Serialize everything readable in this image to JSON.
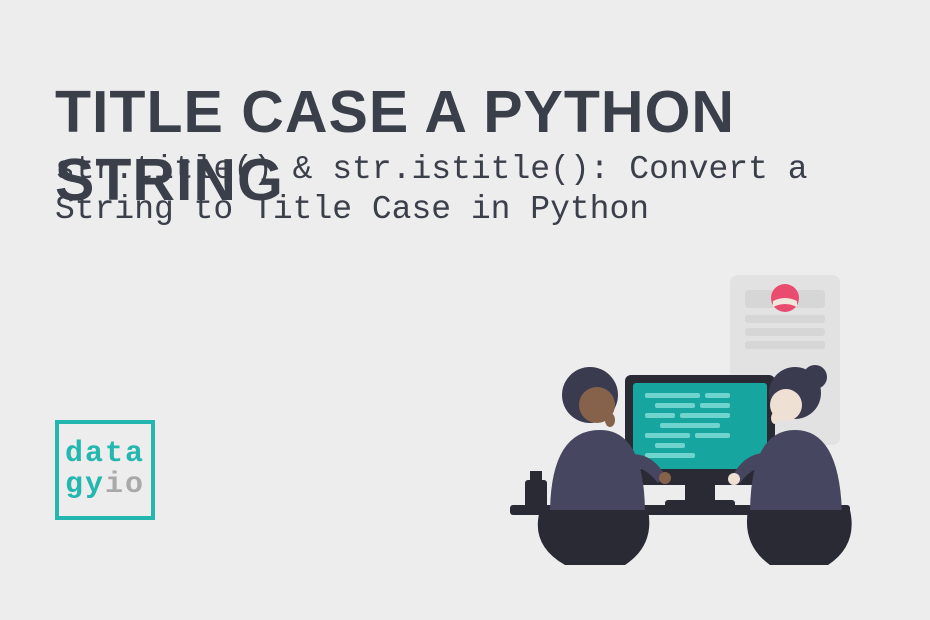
{
  "heading": "TITLE CASE A PYTHON STRING",
  "subheading": "str.title() & str.istitle(): Convert a String to Title Case in Python",
  "logo": {
    "line1": "data",
    "line2a": "gy",
    "line2b": "io"
  },
  "colors": {
    "accent": "#23b7b0",
    "text": "#3a3f4a",
    "bg": "#ededed",
    "muted": "#a9a9a9",
    "pink": "#e94c6f"
  }
}
